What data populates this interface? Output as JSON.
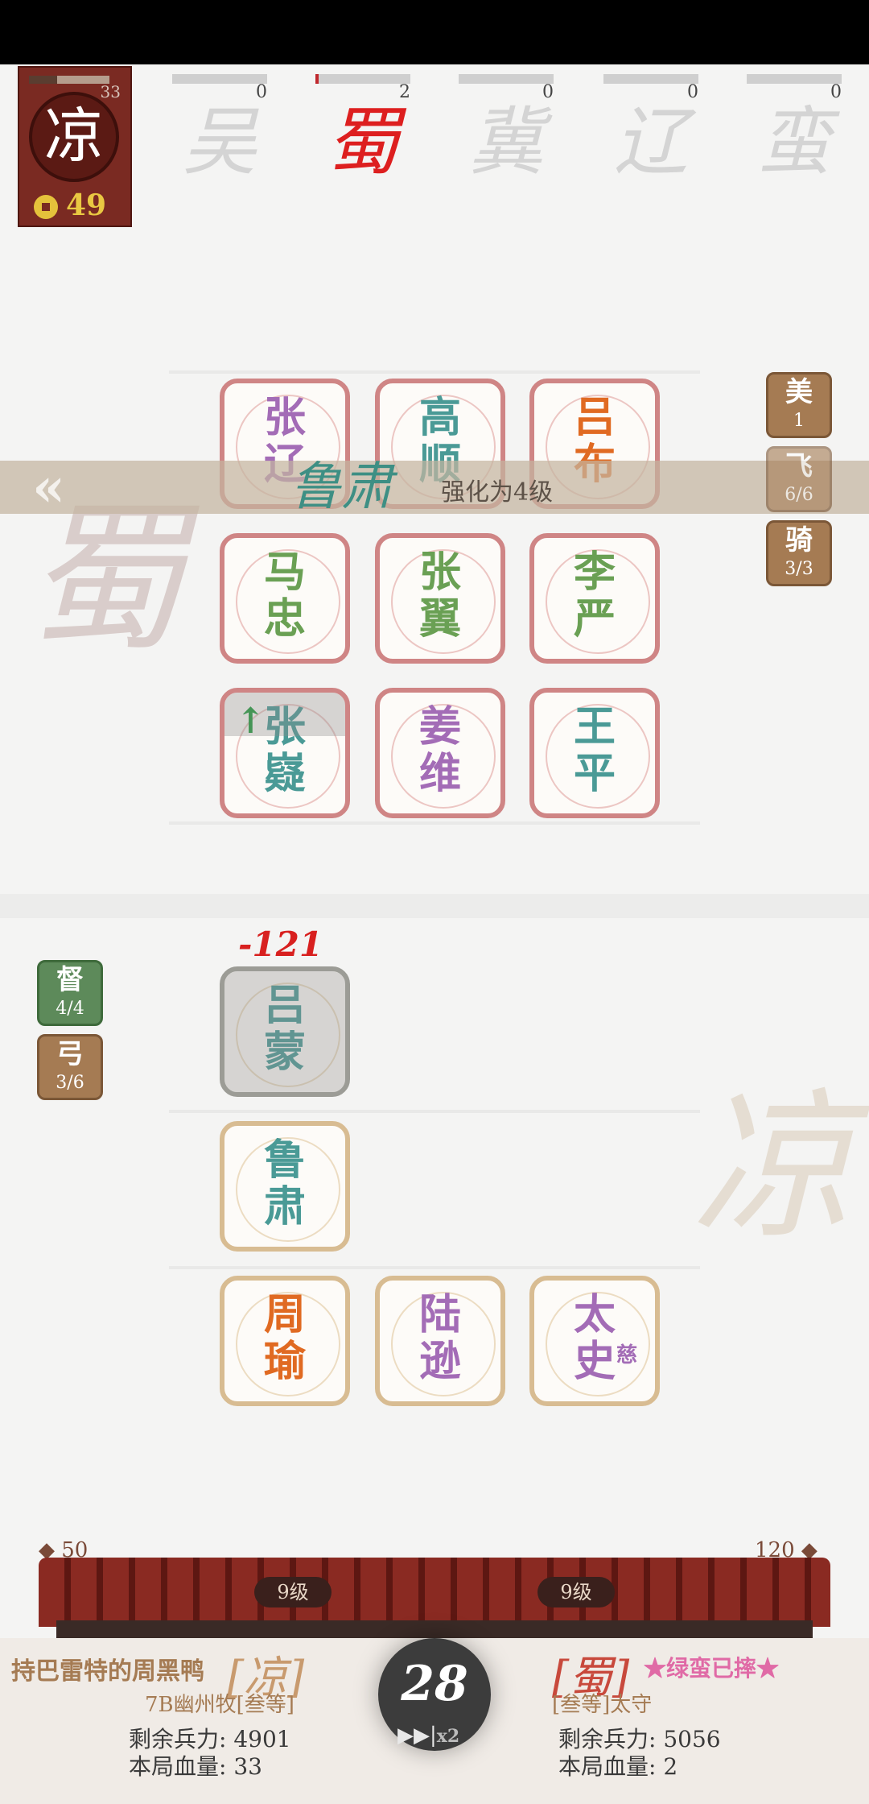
{
  "player": {
    "badge_char": "凉",
    "level": "33",
    "level_progress": 0.35,
    "gold": "49"
  },
  "factions": [
    {
      "name": "吴",
      "count": "0",
      "progress": 0.0
    },
    {
      "name": "蜀",
      "count": "2",
      "progress": 0.03
    },
    {
      "name": "冀",
      "count": "0",
      "progress": 0.0
    },
    {
      "name": "辽",
      "count": "0",
      "progress": 0.0
    },
    {
      "name": "蛮",
      "count": "0",
      "progress": 0.0
    }
  ],
  "background": {
    "enemy_char": "蜀",
    "ally_char": "凉"
  },
  "enemy_tiles": [
    {
      "l1": "张",
      "l2": "辽",
      "color": "purple"
    },
    {
      "l1": "高",
      "l2": "顺",
      "color": "teal"
    },
    {
      "l1": "吕",
      "l2": "布",
      "color": "orange"
    },
    {
      "l1": "马",
      "l2": "忠",
      "color": "green"
    },
    {
      "l1": "张",
      "l2": "翼",
      "color": "green"
    },
    {
      "l1": "李",
      "l2": "严",
      "color": "green"
    },
    {
      "l1": "张",
      "l2": "嶷",
      "color": "teal"
    },
    {
      "l1": "姜",
      "l2": "维",
      "color": "purple"
    },
    {
      "l1": "王",
      "l2": "平",
      "color": "teal"
    }
  ],
  "ally_tiles": [
    {
      "l1": "吕",
      "l2": "蒙",
      "color": "teal"
    },
    {
      "l1": "鲁",
      "l2": "肃",
      "color": "teal"
    },
    {
      "l1": "周",
      "l2": "瑜",
      "color": "orange"
    },
    {
      "l1": "陆",
      "l2": "逊",
      "color": "purple"
    },
    {
      "l1": "太",
      "l2": "史",
      "sub": "慈",
      "color": "purple"
    }
  ],
  "right_tags": [
    {
      "label": "美",
      "value": "1"
    },
    {
      "label": "飞",
      "value": "6/6"
    },
    {
      "label": "骑",
      "value": "3/3"
    }
  ],
  "left_tags": [
    {
      "label": "督",
      "value": "4/4"
    },
    {
      "label": "弓",
      "value": "3/6"
    }
  ],
  "banner": {
    "hero": "鲁肃",
    "text": "强化为4级"
  },
  "damage": "-121",
  "roof": {
    "left_value": "50",
    "right_value": "120",
    "left_level": "9级",
    "right_level": "9级"
  },
  "left_player": {
    "name": "持巴雷特的周黑鸭",
    "faction": "[凉]",
    "title": "7B幽州牧[叁等]",
    "troops_label": "剩余兵力:",
    "troops": "4901",
    "hp_label": "本局血量:",
    "hp": "33"
  },
  "right_player": {
    "faction": "[蜀]",
    "name": "★绿蛮已摔★",
    "title": "[叁等]太守",
    "troops_label": "剩余兵力:",
    "troops": "5056",
    "hp_label": "本局血量:",
    "hp": "2"
  },
  "timer": "28",
  "speed": {
    "icon": "▶▶|",
    "mult": "x2"
  },
  "colors": {
    "enemy_border": "#cf8585",
    "ally_border": "#d8bc92",
    "accent_red": "#dd1f1f"
  }
}
